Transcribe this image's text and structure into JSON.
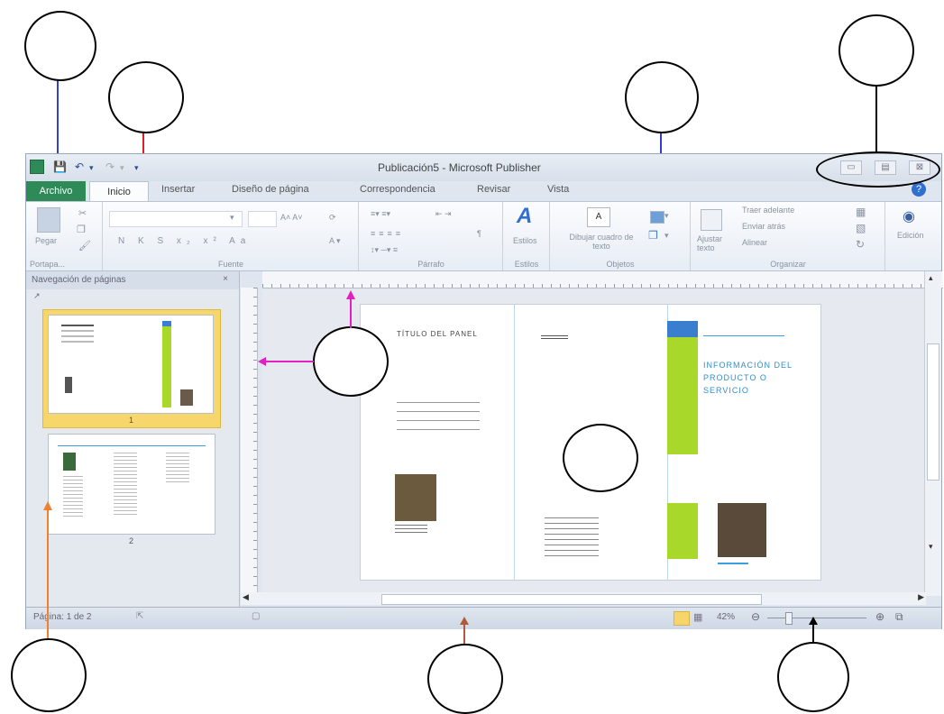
{
  "window": {
    "title": "Publicación5 - Microsoft Publisher",
    "controls": {
      "minimize": "▭",
      "maximize": "▤",
      "close": "⊠"
    }
  },
  "tabs": [
    "Archivo",
    "Inicio",
    "Insertar",
    "Diseño de página",
    "Correspondencia",
    "Revisar",
    "Vista"
  ],
  "ribbon": {
    "groups": {
      "portapapeles": "Portapa...",
      "fuente": "Fuente",
      "parrafo": "Párrafo",
      "estilos": "Estilos",
      "objetos": "Objetos",
      "organizar": "Organizar"
    },
    "pegar": "Pegar",
    "estilos_btn": "Estilos",
    "dibujar": "Dibujar cuadro de texto",
    "ajustar": "Ajustar texto",
    "traer": "Traer adelante",
    "enviar": "Enviar atrás",
    "alinear": "Alinear",
    "edicion": "Edición",
    "font_buttons": "N K S x₂ x² Aa",
    "grow": "A˄ A˅"
  },
  "nav": {
    "title": "Navegación de páginas",
    "page1": "1",
    "page2": "2"
  },
  "page": {
    "title": "TÍTULO DEL PANEL",
    "info": "INFORMACIÓN DEL PRODUCTO O SERVICIO"
  },
  "status": {
    "page": "Página: 1 de 2",
    "zoom": "42%"
  }
}
